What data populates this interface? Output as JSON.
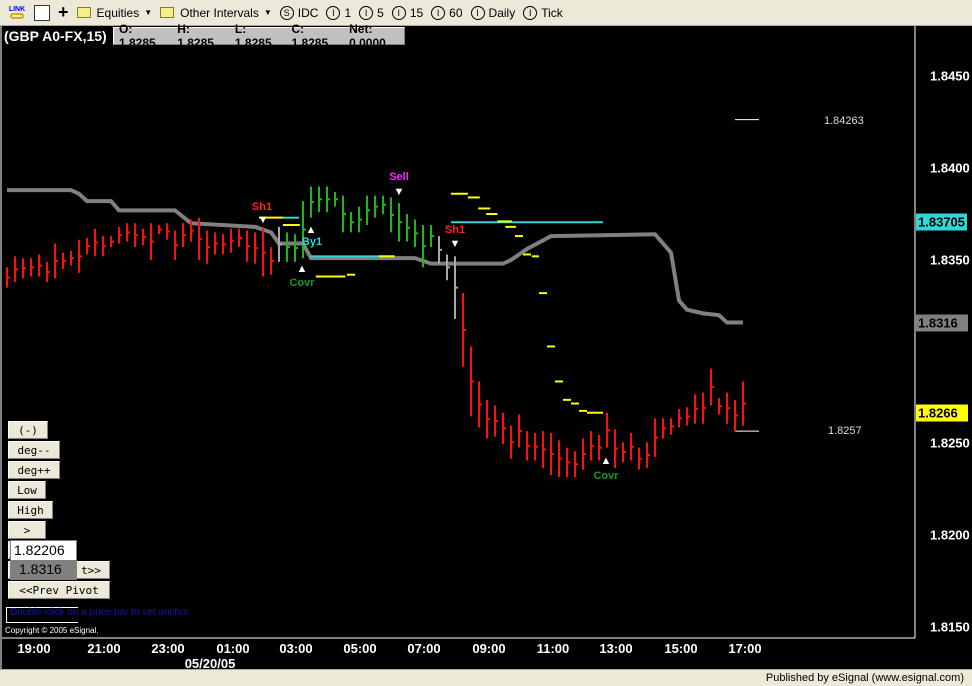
{
  "toolbar": {
    "link_icon_text": "LINK",
    "items": [
      {
        "label": "Equities",
        "icon": "folder-icon",
        "dropdown": true
      },
      {
        "label": "Other Intervals",
        "icon": "folder-icon",
        "dropdown": true
      },
      {
        "label": "IDC",
        "icon": "S"
      },
      {
        "label": "1",
        "icon": "I"
      },
      {
        "label": "5",
        "icon": "I"
      },
      {
        "label": "15",
        "icon": "I"
      },
      {
        "label": "60",
        "icon": "I"
      },
      {
        "label": "Daily",
        "icon": "I"
      },
      {
        "label": "Tick",
        "icon": "I"
      }
    ]
  },
  "header": {
    "symbol": "(GBP A0-FX,15)",
    "ohlc": {
      "open": "O:  1.8285",
      "high": "H:  1.8285",
      "low": "L:  1.8285",
      "close": "C:  1.8285",
      "net": "Net:  0.0000"
    }
  },
  "price_axis": {
    "ticks": [
      "1.8450",
      "1.8400",
      "1.8350",
      "1.8250",
      "1.8200",
      "1.8150"
    ],
    "boxes": [
      {
        "value": "1.83705",
        "color": "#33d6d6"
      },
      {
        "value": "1.8316",
        "color": "#808080"
      },
      {
        "value": "1.8266",
        "color": "#ffff00"
      }
    ]
  },
  "time_axis": {
    "ticks": [
      "19:00",
      "21:00",
      "23:00",
      "01:00",
      "03:00",
      "05:00",
      "07:00",
      "09:00",
      "11:00",
      "13:00",
      "15:00",
      "17:00"
    ],
    "date": "05/20/05"
  },
  "levels": [
    {
      "value": "1.84263"
    },
    {
      "value": "1.8257"
    }
  ],
  "markers": [
    {
      "text": "Sh1",
      "color": "#ff2020",
      "arrow": "down"
    },
    {
      "text": "Covr",
      "color": "#1a9a1a",
      "arrow": "up"
    },
    {
      "text": "By1",
      "color": "#33d6d6",
      "arrow": "up"
    },
    {
      "text": "Sell",
      "color": "#ff22ff",
      "arrow": "down"
    },
    {
      "text": "Sh1",
      "color": "#ff2020",
      "arrow": "down"
    },
    {
      "text": "Covr",
      "color": "#1a9a1a",
      "arrow": "up"
    }
  ],
  "panel": {
    "buttons": [
      "(-)",
      "deg--",
      "deg++",
      "Low",
      "High",
      ">",
      "t>>",
      "<<Prev Pivot"
    ],
    "popup": [
      "1.82206",
      "1.8316"
    ],
    "hint": "Double-click on a price bar to set anchor.",
    "copyright": "Copyright © 2005 eSignal."
  },
  "status": {
    "text": "Published by eSignal (www.esignal.com)"
  },
  "chart_data": {
    "type": "ohlc-bar",
    "interval": "15",
    "ylim": [
      1.815,
      1.845
    ],
    "colors": {
      "r": "#ff1010",
      "g": "#1fb51f",
      "n": "#a8a8a8",
      "ma": "#808080",
      "stop": "#ffff00",
      "target": "#33d6d6"
    },
    "bars": [
      [
        1.8346,
        1.8335,
        "r"
      ],
      [
        1.8352,
        1.8338,
        "r"
      ],
      [
        1.8351,
        1.834,
        "r"
      ],
      [
        1.8351,
        1.8341,
        "r"
      ],
      [
        1.8353,
        1.8341,
        "r"
      ],
      [
        1.8349,
        1.8338,
        "r"
      ],
      [
        1.8359,
        1.834,
        "r"
      ],
      [
        1.8354,
        1.8345,
        "r"
      ],
      [
        1.8355,
        1.8347,
        "r"
      ],
      [
        1.8361,
        1.8343,
        "r"
      ],
      [
        1.8362,
        1.8353,
        "r"
      ],
      [
        1.8367,
        1.8352,
        "r"
      ],
      [
        1.8363,
        1.8352,
        "r"
      ],
      [
        1.8363,
        1.8357,
        "r"
      ],
      [
        1.8368,
        1.8359,
        "r"
      ],
      [
        1.837,
        1.836,
        "r"
      ],
      [
        1.837,
        1.8357,
        "r"
      ],
      [
        1.8367,
        1.8358,
        "r"
      ],
      [
        1.837,
        1.835,
        "r"
      ],
      [
        1.8369,
        1.8364,
        "r"
      ],
      [
        1.837,
        1.8361,
        "r"
      ],
      [
        1.8366,
        1.835,
        "r"
      ],
      [
        1.837,
        1.8357,
        "r"
      ],
      [
        1.8372,
        1.836,
        "r"
      ],
      [
        1.8373,
        1.835,
        "r"
      ],
      [
        1.8366,
        1.8348,
        "r"
      ],
      [
        1.8365,
        1.8353,
        "r"
      ],
      [
        1.8364,
        1.8353,
        "r"
      ],
      [
        1.8367,
        1.8354,
        "r"
      ],
      [
        1.8367,
        1.8357,
        "r"
      ],
      [
        1.8366,
        1.8349,
        "r"
      ],
      [
        1.8365,
        1.8348,
        "r"
      ],
      [
        1.8367,
        1.8341,
        "r"
      ],
      [
        1.8357,
        1.8342,
        "r"
      ],
      [
        1.8368,
        1.8349,
        "n"
      ],
      [
        1.8365,
        1.8349,
        "g"
      ],
      [
        1.8364,
        1.8349,
        "g"
      ],
      [
        1.8382,
        1.8351,
        "g"
      ],
      [
        1.839,
        1.8373,
        "g"
      ],
      [
        1.839,
        1.8376,
        "g"
      ],
      [
        1.839,
        1.8376,
        "g"
      ],
      [
        1.8387,
        1.8379,
        "g"
      ],
      [
        1.8385,
        1.8365,
        "g"
      ],
      [
        1.8376,
        1.8365,
        "g"
      ],
      [
        1.8379,
        1.8365,
        "g"
      ],
      [
        1.8385,
        1.8369,
        "g"
      ],
      [
        1.8385,
        1.8373,
        "g"
      ],
      [
        1.8385,
        1.8375,
        "g"
      ],
      [
        1.8384,
        1.8365,
        "g"
      ],
      [
        1.8381,
        1.836,
        "g"
      ],
      [
        1.8375,
        1.836,
        "g"
      ],
      [
        1.8372,
        1.8357,
        "g"
      ],
      [
        1.8369,
        1.8346,
        "g"
      ],
      [
        1.8369,
        1.8357,
        "g"
      ],
      [
        1.8363,
        1.8348,
        "n"
      ],
      [
        1.8353,
        1.8339,
        "n"
      ],
      [
        1.8352,
        1.8318,
        "n"
      ],
      [
        1.8332,
        1.8292,
        "r"
      ],
      [
        1.8303,
        1.8265,
        "r"
      ],
      [
        1.8284,
        1.8259,
        "r"
      ],
      [
        1.8274,
        1.8253,
        "r"
      ],
      [
        1.8271,
        1.8254,
        "r"
      ],
      [
        1.8267,
        1.825,
        "r"
      ],
      [
        1.826,
        1.8242,
        "r"
      ],
      [
        1.8266,
        1.8248,
        "r"
      ],
      [
        1.8257,
        1.8241,
        "r"
      ],
      [
        1.8256,
        1.8241,
        "r"
      ],
      [
        1.8257,
        1.8237,
        "r"
      ],
      [
        1.8256,
        1.8233,
        "r"
      ],
      [
        1.8252,
        1.8232,
        "r"
      ],
      [
        1.8248,
        1.8232,
        "r"
      ],
      [
        1.8246,
        1.8232,
        "r"
      ],
      [
        1.8253,
        1.8236,
        "r"
      ],
      [
        1.8257,
        1.8241,
        "r"
      ],
      [
        1.8255,
        1.8241,
        "r"
      ],
      [
        1.8267,
        1.8248,
        "r"
      ],
      [
        1.8258,
        1.8237,
        "r"
      ],
      [
        1.8251,
        1.824,
        "r"
      ],
      [
        1.8256,
        1.8241,
        "r"
      ],
      [
        1.8248,
        1.8236,
        "r"
      ],
      [
        1.8251,
        1.8237,
        "r"
      ],
      [
        1.8264,
        1.8243,
        "r"
      ],
      [
        1.8264,
        1.8253,
        "r"
      ],
      [
        1.8264,
        1.8255,
        "r"
      ],
      [
        1.8269,
        1.8259,
        "r"
      ],
      [
        1.827,
        1.826,
        "r"
      ],
      [
        1.8277,
        1.8261,
        "r"
      ],
      [
        1.8278,
        1.8261,
        "r"
      ],
      [
        1.8291,
        1.8271,
        "r"
      ],
      [
        1.8275,
        1.8266,
        "r"
      ],
      [
        1.8278,
        1.8261,
        "r"
      ],
      [
        1.8274,
        1.8257,
        "r"
      ],
      [
        1.8284,
        1.826,
        "r"
      ]
    ],
    "moving_line": [
      [
        0,
        1.8388
      ],
      [
        8,
        1.8388
      ],
      [
        9,
        1.8386
      ],
      [
        10,
        1.8382
      ],
      [
        13,
        1.8382
      ],
      [
        14,
        1.8377
      ],
      [
        21,
        1.8377
      ],
      [
        23,
        1.837
      ],
      [
        31,
        1.8368
      ],
      [
        33,
        1.8365
      ],
      [
        34,
        1.8359
      ],
      [
        37,
        1.8359
      ],
      [
        38,
        1.8351
      ],
      [
        51,
        1.8351
      ],
      [
        53,
        1.8348
      ],
      [
        62,
        1.8348
      ],
      [
        63,
        1.835
      ],
      [
        65,
        1.8356
      ],
      [
        68,
        1.8363
      ],
      [
        81,
        1.8364
      ],
      [
        83,
        1.8354
      ],
      [
        84,
        1.8328
      ],
      [
        85,
        1.8323
      ],
      [
        87,
        1.8321
      ],
      [
        89,
        1.832
      ],
      [
        90,
        1.8316
      ],
      [
        92,
        1.8316
      ]
    ],
    "stops": [
      [
        31.5,
        34.5,
        1.8373
      ],
      [
        34.5,
        36.6,
        1.8369
      ],
      [
        38.6,
        42.3,
        1.8341
      ],
      [
        42.5,
        43.5,
        1.8342
      ],
      [
        46.5,
        48.4,
        1.8352
      ],
      [
        55.5,
        57.6,
        1.8386
      ],
      [
        57.6,
        59.1,
        1.8384
      ],
      [
        58.9,
        60.4,
        1.8378
      ],
      [
        59.9,
        61.3,
        1.8375
      ],
      [
        61.3,
        63.1,
        1.8371
      ],
      [
        62.3,
        63.6,
        1.8368
      ],
      [
        63.5,
        64.5,
        1.8363
      ],
      [
        64.5,
        65.5,
        1.8353
      ],
      [
        65.6,
        66.5,
        1.8352
      ],
      [
        66.5,
        67.5,
        1.8332
      ],
      [
        67.5,
        68.5,
        1.8303
      ],
      [
        68.5,
        69.5,
        1.8284
      ],
      [
        69.5,
        70.5,
        1.8274
      ],
      [
        70.5,
        71.5,
        1.8272
      ],
      [
        71.5,
        72.5,
        1.8268
      ],
      [
        72.5,
        74.5,
        1.8267
      ]
    ],
    "targets": [
      [
        34.5,
        36.5,
        1.8373
      ],
      [
        37.9,
        48.5,
        1.8352
      ],
      [
        55.5,
        74.5,
        1.83705
      ]
    ],
    "level_lines": [
      1.84263,
      1.8257
    ]
  }
}
